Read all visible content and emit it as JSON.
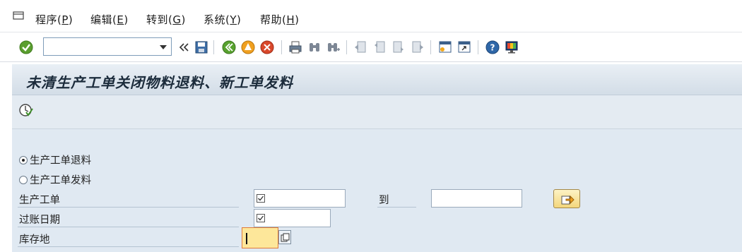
{
  "menubar": {
    "items": [
      {
        "label": "程序(",
        "key": "P",
        "tail": ")"
      },
      {
        "label": "编辑(",
        "key": "E",
        "tail": ")"
      },
      {
        "label": "转到(",
        "key": "G",
        "tail": ")"
      },
      {
        "label": "系统(",
        "key": "Y",
        "tail": ")"
      },
      {
        "label": "帮助(",
        "key": "H",
        "tail": ")"
      }
    ]
  },
  "toolbar": {
    "command_field_value": "",
    "icons": [
      "enter-icon",
      "back-arrows-icon",
      "save-icon",
      "back-icon",
      "exit-icon",
      "cancel-icon",
      "print-icon",
      "find-icon",
      "find-next-icon",
      "first-page-icon",
      "previous-page-icon",
      "next-page-icon",
      "last-page-icon",
      "create-session-icon",
      "shortcut-icon",
      "help-icon",
      "customize-layout-icon"
    ]
  },
  "screen": {
    "title": "未清生产工单关闭物料退料、新工单发料"
  },
  "form": {
    "radio_return": "生产工单退料",
    "radio_issue": "生产工单发料",
    "selected_radio": "return",
    "label_order": "生产工单",
    "label_posting_date": "过账日期",
    "label_storage": "库存地",
    "to_label": "到",
    "order_from_value": "",
    "order_to_value": "",
    "posting_date_value": "",
    "storage_value": ""
  },
  "colors": {
    "content_bg": "#e0e9f2",
    "title_bg": "#d3dde7",
    "focus_field": "#fde79a",
    "focus_border": "#e07b39"
  }
}
